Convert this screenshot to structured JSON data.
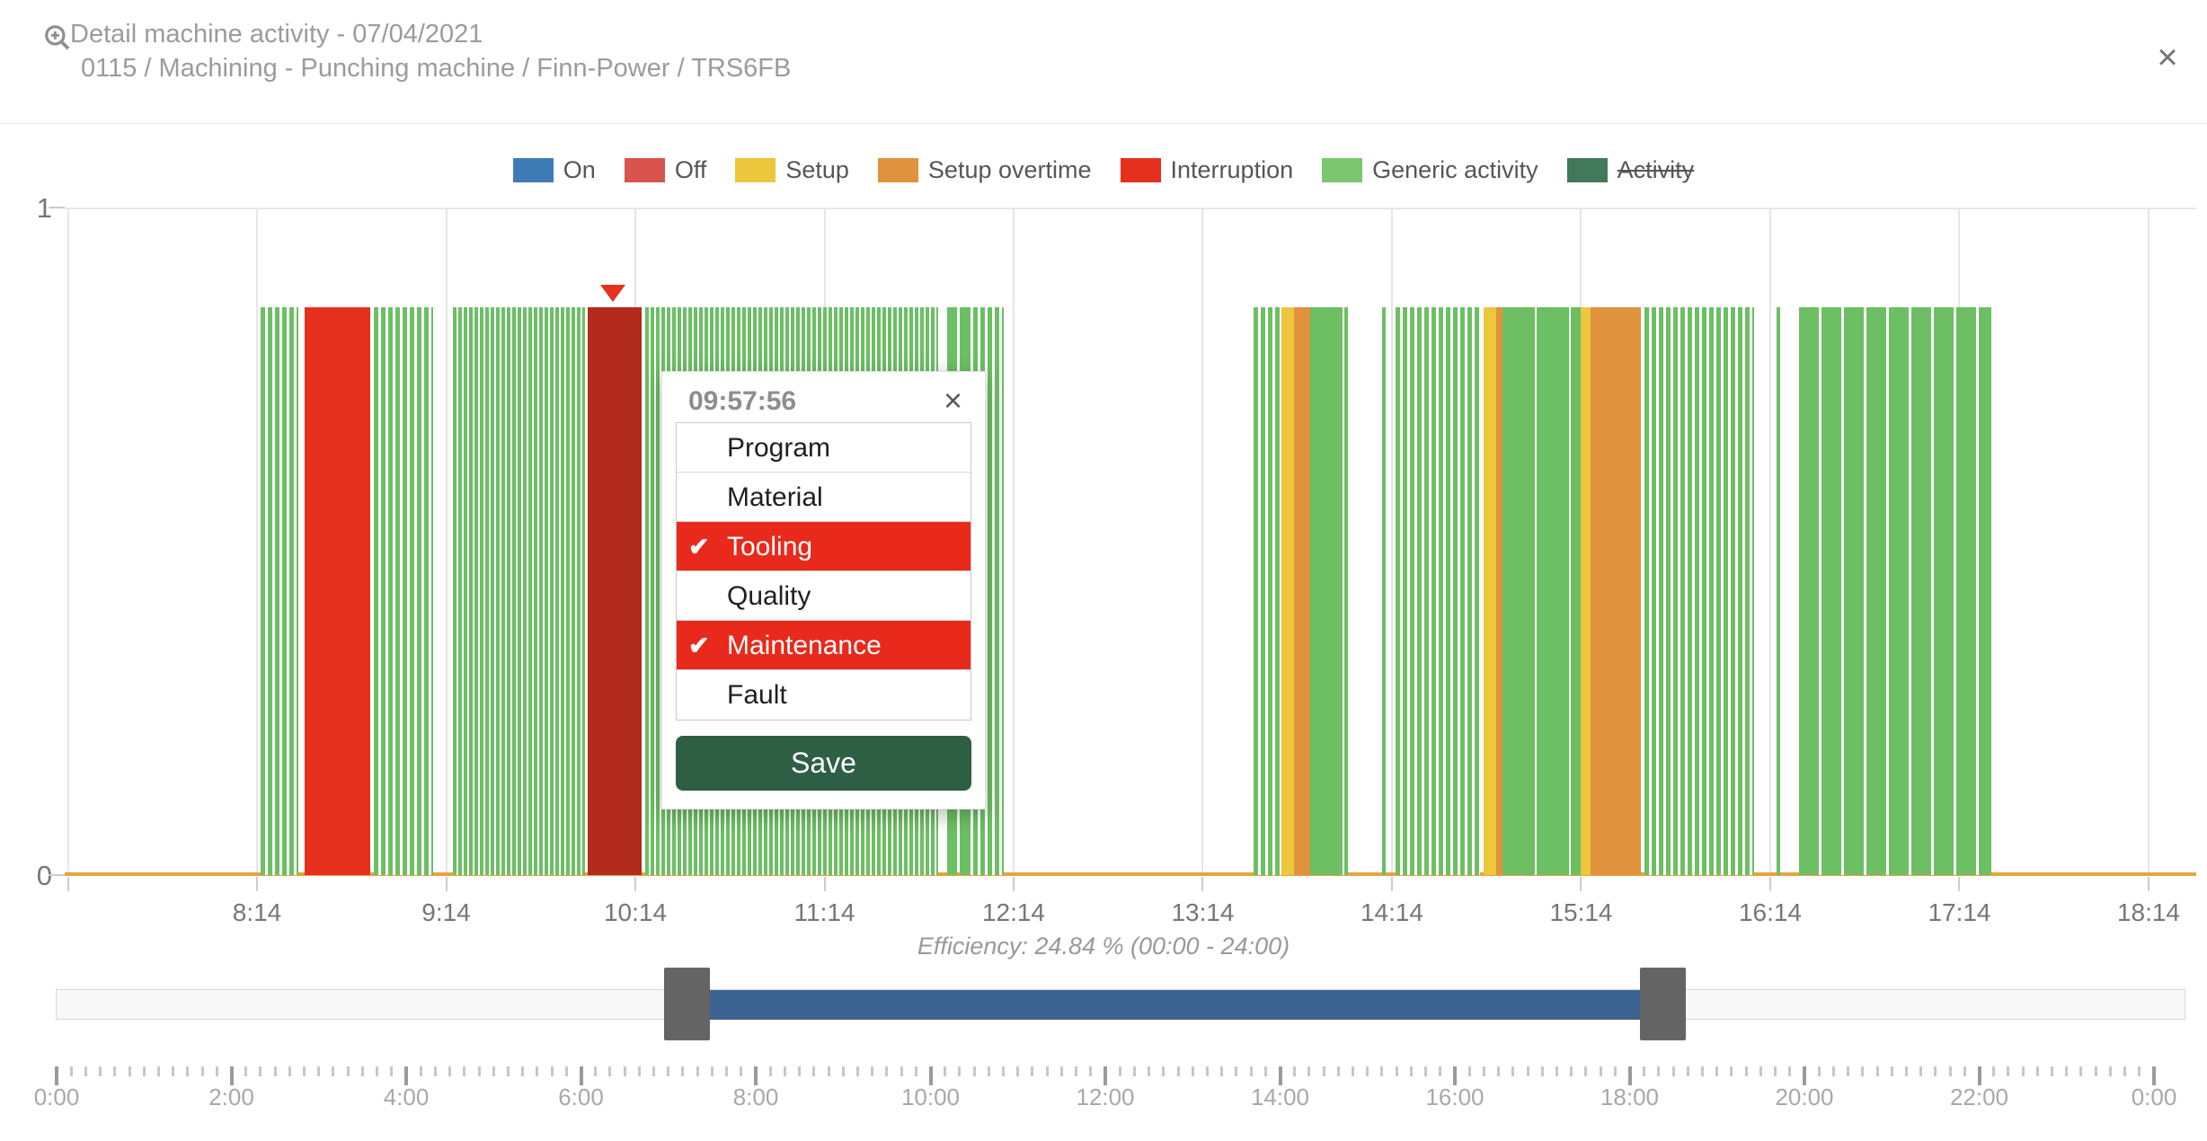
{
  "header": {
    "title": "Detail machine activity - 07/04/2021",
    "subtitle": "0115 / Machining - Punching machine / Finn-Power / TRS6FB",
    "close_glyph": "×"
  },
  "legend": {
    "items": [
      {
        "label": "On",
        "color": "#3f7cb6",
        "struck": false
      },
      {
        "label": "Off",
        "color": "#d9534f",
        "struck": false
      },
      {
        "label": "Setup",
        "color": "#ecc63d",
        "struck": false
      },
      {
        "label": "Setup overtime",
        "color": "#e0923c",
        "struck": false
      },
      {
        "label": "Interruption",
        "color": "#e5301d",
        "struck": false
      },
      {
        "label": "Generic activity",
        "color": "#7bc66f",
        "struck": false
      },
      {
        "label": "Activity",
        "color": "#41795a",
        "struck": true
      }
    ]
  },
  "chart_data": {
    "type": "bar",
    "title": "Detail machine activity - 07/04/2021",
    "y_axis": {
      "min": 0,
      "max": 1,
      "max_label": "1",
      "min_label": "0"
    },
    "x_axis": {
      "visible_start": "7:13",
      "visible_end": "18:28",
      "hour_labels": [
        "8:14",
        "9:14",
        "10:14",
        "11:14",
        "12:14",
        "13:14",
        "14:14",
        "15:14",
        "16:14",
        "17:14",
        "18:14"
      ],
      "gridline_times": [
        "7:14",
        "8:14",
        "9:14",
        "10:14",
        "11:14",
        "12:14",
        "13:14",
        "14:14",
        "15:14",
        "16:14",
        "17:14",
        "18:14"
      ]
    },
    "bar_value": 0.85,
    "baseline_color": "#e8a33d",
    "marker_time": "10:07",
    "colors": {
      "generic": "#6cbf63",
      "interruption": "#e5301d",
      "interruption-marked": "#b22b1c",
      "setup": "#ecc63d",
      "setup-overtime": "#e0923c"
    },
    "segments": [
      {
        "start": "8:15",
        "end": "8:27",
        "category": "generic",
        "pattern": "striped"
      },
      {
        "start": "8:29",
        "end": "8:50",
        "category": "interruption",
        "pattern": "plain"
      },
      {
        "start": "8:51",
        "end": "9:10",
        "category": "generic",
        "pattern": "striped"
      },
      {
        "start": "9:16",
        "end": "9:58",
        "category": "generic",
        "pattern": "striped-dense"
      },
      {
        "start": "9:59",
        "end": "10:16",
        "category": "interruption-marked",
        "pattern": "plain"
      },
      {
        "start": "10:17",
        "end": "11:50",
        "category": "generic",
        "pattern": "striped-dense"
      },
      {
        "start": "11:53",
        "end": "11:56",
        "category": "generic",
        "pattern": "solid"
      },
      {
        "start": "11:57",
        "end": "11:59",
        "category": "generic",
        "pattern": "solid"
      },
      {
        "start": "11:59",
        "end": "12:11",
        "category": "generic",
        "pattern": "striped"
      },
      {
        "start": "13:30",
        "end": "13:39",
        "category": "generic",
        "pattern": "striped"
      },
      {
        "start": "13:39",
        "end": "13:43",
        "category": "setup",
        "pattern": "plain"
      },
      {
        "start": "13:43",
        "end": "13:48",
        "category": "setup-overtime",
        "pattern": "plain"
      },
      {
        "start": "13:48",
        "end": "14:00",
        "category": "generic",
        "pattern": "solid-lined"
      },
      {
        "start": "14:11",
        "end": "14:12",
        "category": "generic",
        "pattern": "solid"
      },
      {
        "start": "14:15",
        "end": "14:42",
        "category": "generic",
        "pattern": "striped"
      },
      {
        "start": "14:43",
        "end": "14:47",
        "category": "setup",
        "pattern": "plain"
      },
      {
        "start": "14:47",
        "end": "14:49",
        "category": "setup-overtime",
        "pattern": "plain"
      },
      {
        "start": "14:49",
        "end": "15:14",
        "category": "generic",
        "pattern": "solid-lined"
      },
      {
        "start": "15:14",
        "end": "15:17",
        "category": "setup",
        "pattern": "plain"
      },
      {
        "start": "15:17",
        "end": "15:33",
        "category": "setup-overtime",
        "pattern": "plain"
      },
      {
        "start": "15:34",
        "end": "16:09",
        "category": "generic",
        "pattern": "striped"
      },
      {
        "start": "16:16",
        "end": "16:17",
        "category": "generic",
        "pattern": "solid"
      },
      {
        "start": "16:23",
        "end": "17:24",
        "category": "generic",
        "pattern": "blocks"
      }
    ]
  },
  "popup": {
    "title": "09:57:56",
    "close_glyph": "×",
    "check_glyph": "✔",
    "selected_color": "#e8291c",
    "options": [
      {
        "label": "Program",
        "selected": false
      },
      {
        "label": "Material",
        "selected": false
      },
      {
        "label": "Tooling",
        "selected": true
      },
      {
        "label": "Quality",
        "selected": false
      },
      {
        "label": "Maintenance",
        "selected": true
      },
      {
        "label": "Fault",
        "selected": false
      }
    ],
    "save_label": "Save",
    "save_color": "#2e5f45"
  },
  "footer": {
    "efficiency": "Efficiency: 24.84 % (00:00 - 24:00)"
  },
  "slider": {
    "range_start": "0:00",
    "range_end": "24:00",
    "selection_start": "7:13",
    "selection_end": "18:23",
    "bar_color": "#3d6390"
  },
  "ruler": {
    "labels": [
      "0:00",
      "2:00",
      "4:00",
      "6:00",
      "8:00",
      "10:00",
      "12:00",
      "14:00",
      "16:00",
      "18:00",
      "20:00",
      "22:00",
      "0:00"
    ],
    "minor_tick_minutes": 10,
    "major_tick_minutes": 120
  }
}
